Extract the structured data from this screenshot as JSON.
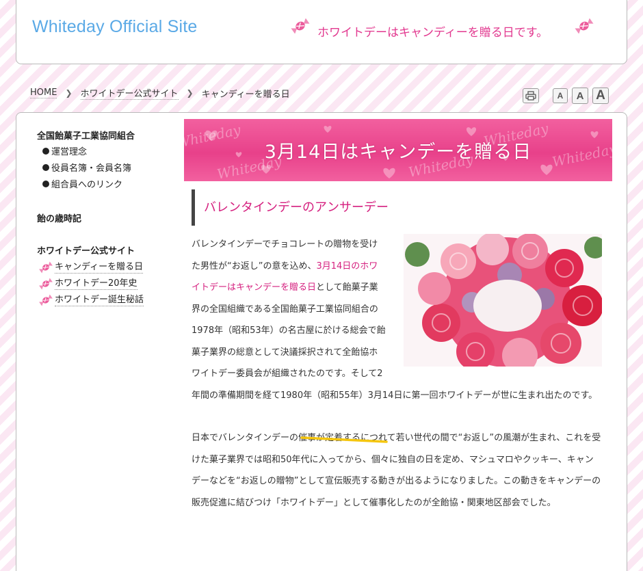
{
  "header": {
    "site_title": "Whiteday Official Site",
    "tagline": "ホワイトデーはキャンディーを贈る日です。"
  },
  "breadcrumb": {
    "items": [
      "HOME",
      "ホワイトデー公式サイト",
      "キャンディーを贈る日"
    ]
  },
  "tools": {
    "print_icon": "printer-icon",
    "font_small": "A",
    "font_medium": "A",
    "font_large": "A"
  },
  "sidebar": {
    "group1_title": "全国飴菓子工業協同組合",
    "group1_items": [
      "運営理念",
      "役員名簿・会員名簿",
      "組合員へのリンク"
    ],
    "group2_title": "飴の歳時記",
    "group3_title": "ホワイトデー公式サイト",
    "group3_items": [
      "キャンディーを贈る日",
      "ホワイトデー20年史",
      "ホワイトデー誕生秘話"
    ]
  },
  "banner": {
    "text": "3月14日はキャンデーを贈る日"
  },
  "article": {
    "heading": "バレンタインデーのアンサーデー",
    "p1_before": "バレンタインデーでチョコレートの贈物を受けた男性が“お返し”の意を込め、",
    "p1_highlight": "3月14日のホワイトデーはキャンデーを贈る日",
    "p1_after": "として飴菓子業界の全国組織である全国飴菓子工業協同組合の1978年（昭和53年）の名古屋に於ける総会で飴菓子業界の総意として決議採択されて全飴協ホワイトデー委員会が組織されたのです。そして2年間の準備期間を経て1980年（昭和55年）3月14日に第一回ホワイトデーが世に生まれ出たのです。",
    "p2": "日本でバレンタインデーの催事が定着するにつれて若い世代の間で“お返し”の風潮が生まれ、これを受けた菓子業界では昭和50年代に入ってから、個々に独自の日を定め、マシュマロやクッキー、キャンデーなどを“お返しの贈物”として宣伝販売する動きが出るようになりました。この動きをキャンデーの販売促進に結びつけ「ホワイトデー」として催事化したのが全飴協・関東地区部会でした。"
  },
  "colors": {
    "accent_pink": "#d5207f",
    "title_blue": "#5aa9e6",
    "stripe": "#fbe7f3"
  }
}
